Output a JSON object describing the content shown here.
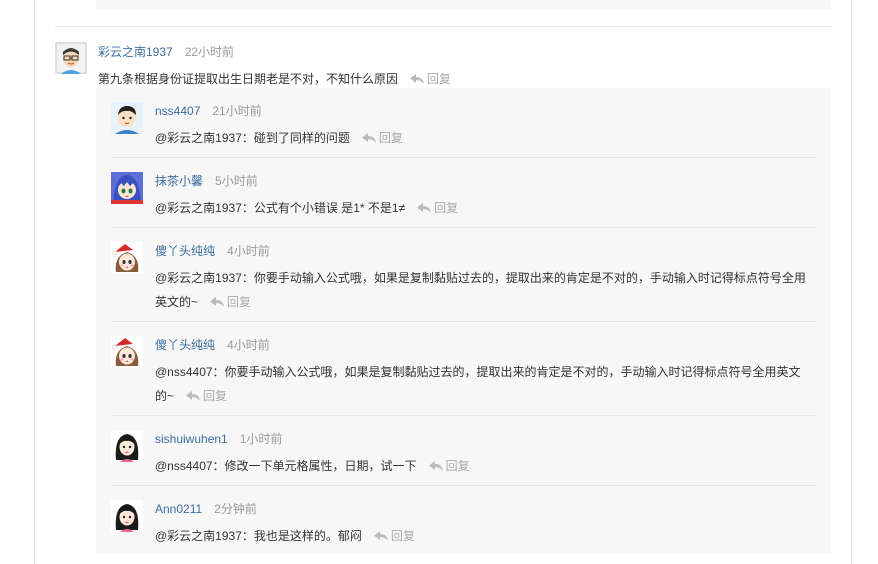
{
  "main": {
    "user": "彩云之南1937",
    "time": "22小时前",
    "text": "第九条根据身份证提取出生日期老是不对，不知什么原因",
    "reply_label": "回复"
  },
  "replies": [
    {
      "user": "nss4407",
      "time": "21小时前",
      "text": "@彩云之南1937：碰到了同样的问题",
      "reply_label": "回复"
    },
    {
      "user": "抹茶小馨",
      "time": "5小时前",
      "text": "@彩云之南1937：公式有个小错误 是1* 不是1≠",
      "reply_label": "回复"
    },
    {
      "user": "傻丫头纯纯",
      "time": "4小时前",
      "text_line1": "@彩云之南1937：你要手动输入公式哦，如果是复制黏贴过去的，提取出来的肯定是不对的，手动输入时记得标点符号全用",
      "text_line2": "英文的~",
      "reply_label": "回复"
    },
    {
      "user": "傻丫头纯纯",
      "time": "4小时前",
      "text_line1": "@nss4407：你要手动输入公式哦，如果是复制黏贴过去的，提取出来的肯定是不对的，手动输入时记得标点符号全用英文",
      "text_line2": "的~",
      "reply_label": "回复"
    },
    {
      "user": "sishuiwuhen1",
      "time": "1小时前",
      "text": "@nss4407：修改一下单元格属性，日期，试一下",
      "reply_label": "回复"
    },
    {
      "user": "Ann0211",
      "time": "2分钟前",
      "text": "@彩云之南1937：我也是这样的。郁闷",
      "reply_label": "回复"
    }
  ]
}
